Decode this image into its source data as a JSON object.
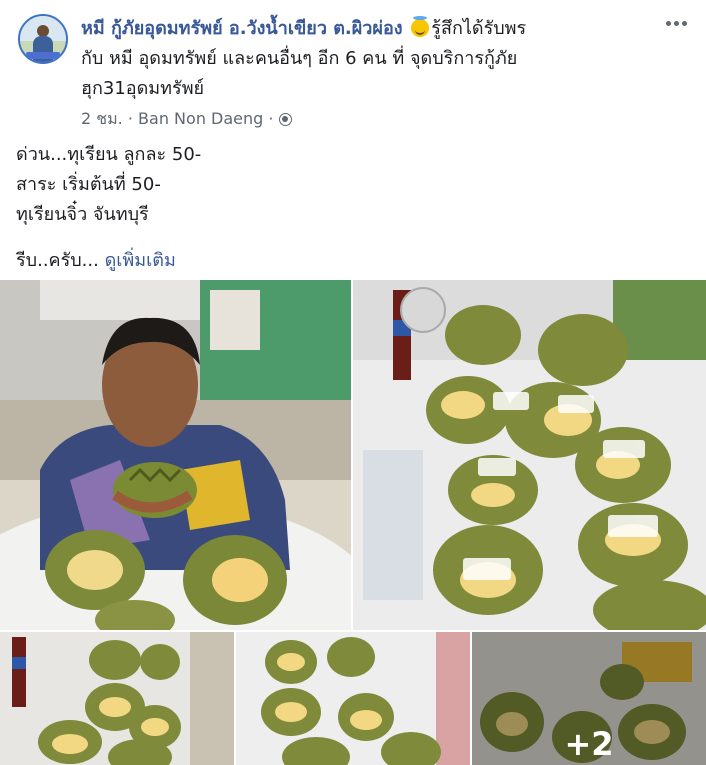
{
  "post": {
    "author_name": "หมี กู้ภัยอุดมทรัพย์ อ.วังน้ำเขียว ต.ผิวผ่อง",
    "feeling_text": "รู้สึกได้รับพร",
    "tagline_line2": "กับ หมี อุดมทรัพย์ และคนอื่นๆ อีก 6 คน",
    "at_text": "ที่",
    "place_part1": "จุดบริการกู้ภัย",
    "place_part2": "ฮุก31อุดมทรัพย์",
    "time": "2 ชม.",
    "separator": "·",
    "location": "Ban Non Daeng",
    "body_lines": [
      "ด่วน...ทุเรียน ลูกละ 50-",
      "สาระ เริ่มต้นที่ 50-",
      "ทุเรียนจิ๋ว จันทบุรี"
    ],
    "body_last": "รีบ..ครับ...",
    "see_more": "ดูเพิ่มเติม"
  },
  "photos": {
    "extra_count": "+2"
  },
  "icons": {
    "feeling": "angel-face-icon",
    "privacy": "globe-icon",
    "menu": "more-options-icon"
  },
  "colors": {
    "link": "#385898",
    "meta": "#616770",
    "text": "#1c1e21"
  }
}
